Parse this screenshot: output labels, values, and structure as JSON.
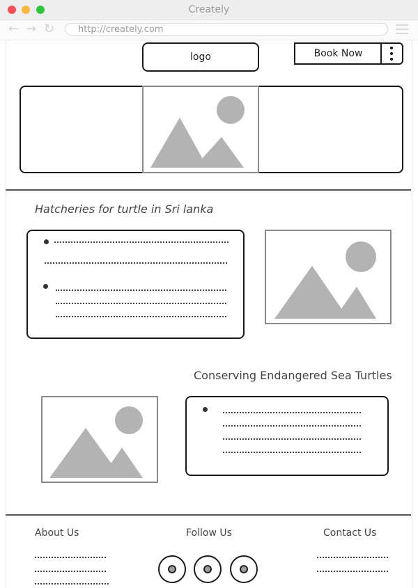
{
  "window": {
    "title": "Creately",
    "url": "http://creately.com"
  },
  "header": {
    "logo_label": "logo",
    "book_now_label": "Book Now"
  },
  "sections": [
    {
      "title": "Hatcheries for turtle in Sri lanka"
    },
    {
      "title": "Conserving Endangered Sea Turtles"
    }
  ],
  "footer": {
    "about_label": "About Us",
    "follow_label": "Follow Us",
    "contact_label": "Contact Us"
  },
  "colors": {
    "placeholder_gray": "#b3b3b3",
    "close_dot": "#f25056",
    "minimize_dot": "#f6b73f",
    "maximize_dot": "#31c43c"
  },
  "icons": [
    "back-arrow-icon",
    "forward-arrow-icon",
    "reload-icon",
    "menu-icon",
    "more-vertical-icon",
    "image-placeholder-icon",
    "social-icon"
  ]
}
